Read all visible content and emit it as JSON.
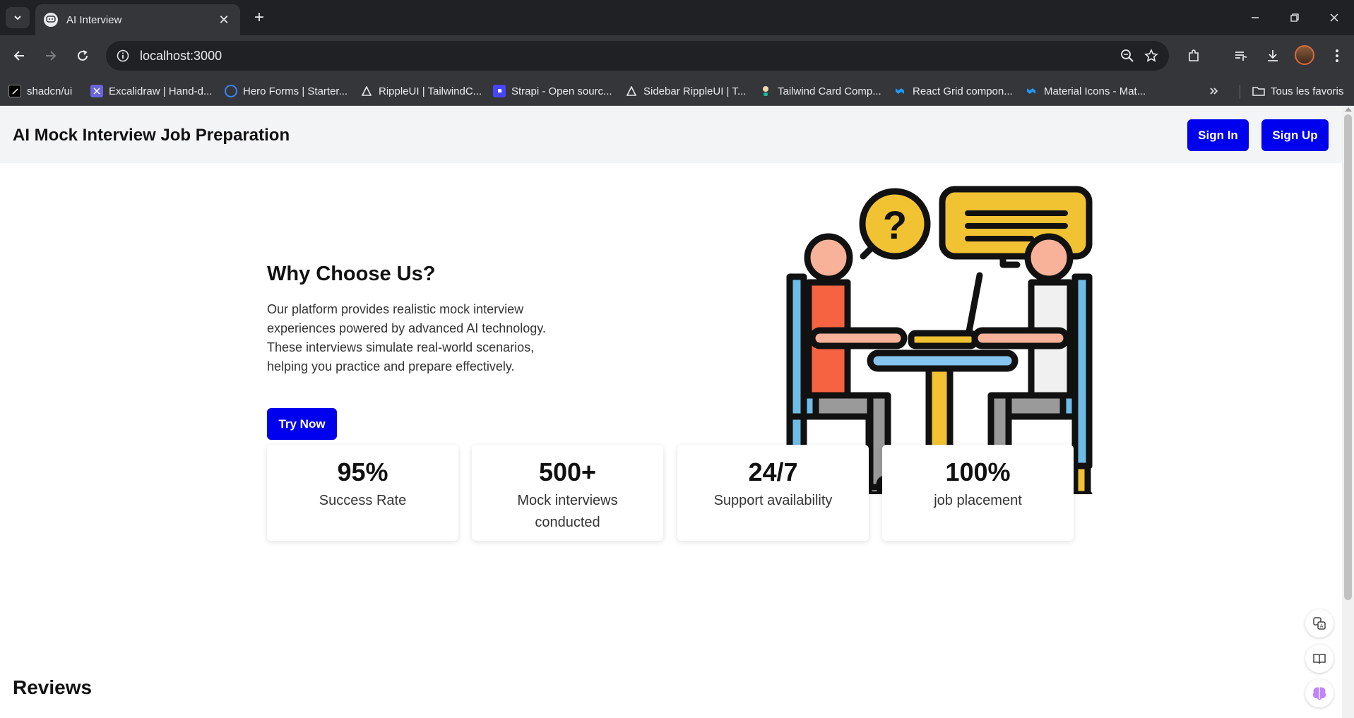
{
  "browser": {
    "tab_title": "AI Interview",
    "url": "localhost:3000",
    "bookmarks": [
      {
        "label": "shadcn/ui",
        "icon": "shadcn-icon"
      },
      {
        "label": "Excalidraw | Hand-d...",
        "icon": "excalidraw-icon"
      },
      {
        "label": "Hero Forms | Starter...",
        "icon": "hero-forms-icon"
      },
      {
        "label": "RippleUI | TailwindC...",
        "icon": "rippleui-icon"
      },
      {
        "label": "Strapi - Open sourc...",
        "icon": "strapi-icon"
      },
      {
        "label": "Sidebar RippleUI | T...",
        "icon": "rippleui-icon"
      },
      {
        "label": "Tailwind Card Comp...",
        "icon": "tailwind-card-icon"
      },
      {
        "label": "React Grid compon...",
        "icon": "mui-icon"
      },
      {
        "label": "Material Icons - Mat...",
        "icon": "mui-icon"
      }
    ],
    "all_bookmarks_label": "Tous les favoris"
  },
  "header": {
    "title": "AI Mock Interview Job Preparation",
    "sign_in": "Sign In",
    "sign_up": "Sign Up"
  },
  "hero": {
    "title": "Why Choose Us?",
    "text": "Our platform provides realistic mock interview experiences powered by advanced AI technology. These interviews simulate real-world scenarios, helping you practice and prepare effectively.",
    "cta": "Try Now",
    "illustration": "interview-illustration"
  },
  "stats": [
    {
      "value": "95%",
      "label": "Success Rate"
    },
    {
      "value": "500+",
      "label": "Mock interviews conducted"
    },
    {
      "value": "24/7",
      "label": "Support availability"
    },
    {
      "value": "100%",
      "label": "job placement"
    }
  ],
  "reviews": {
    "title": "Reviews"
  },
  "colors": {
    "primary": "#0000ee",
    "header_bg": "#f3f4f6",
    "chrome_dark": "#202124",
    "chrome_mid": "#35363a"
  }
}
